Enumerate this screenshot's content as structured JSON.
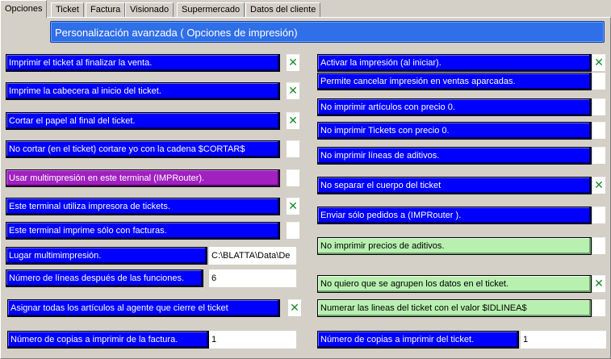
{
  "tabs": [
    {
      "label": "Opciones"
    },
    {
      "label": "Ticket"
    },
    {
      "label": "Factura"
    },
    {
      "label": "Visionado"
    },
    {
      "label": "Supermercado"
    },
    {
      "label": "Datos del cliente"
    }
  ],
  "header": {
    "title": "Personalización avanzada ( Opciones de impresión)"
  },
  "left": [
    {
      "label": "Imprimir el ticket al finalizar la venta.",
      "checked": true,
      "check_mark": "✕"
    },
    {
      "label": "Imprime la cabecera al inicio del ticket.",
      "checked": true,
      "check_mark": "✕"
    },
    {
      "label": "Cortar el papel al final del ticket.",
      "checked": true,
      "check_mark": "✕"
    },
    {
      "label": "No cortar (en el ticket) cortare yo con la cadena $CORTAR$",
      "checked": false,
      "check_mark": ""
    },
    {
      "label": "Usar multimpresión en este terminal (IMPRouter).",
      "checked": false,
      "check_mark": ""
    },
    {
      "label": "Este terminal  utiliza impresora de tickets.",
      "checked": true,
      "check_mark": "✕"
    },
    {
      "label": "Este terminal imprime sólo con facturas.",
      "checked": false,
      "check_mark": ""
    },
    {
      "label": "Lugar multimimpresión.",
      "value": "C:\\BLATTA\\Data\\De"
    },
    {
      "label": "Número de líneas después de las funciones.",
      "value": "6"
    },
    {
      "label": "Asignar todas los artículos al agente que cierre el ticket",
      "checked": true,
      "check_mark": "✕"
    },
    {
      "label": "Número de copias a imprimir de la factura.",
      "value": "1"
    }
  ],
  "right": [
    {
      "label": "Activar la impresión (al iniciar).",
      "checked": true,
      "check_mark": "✕"
    },
    {
      "label": "Permite cancelar impresión en ventas aparcadas.",
      "checked": false,
      "check_mark": ""
    },
    {
      "label": "No imprimir artículos con precio 0.",
      "checked": false,
      "check_mark": ""
    },
    {
      "label": "No imprimir Tickets con precio 0.",
      "checked": false,
      "check_mark": ""
    },
    {
      "label": "No imprimir líneas de aditivos.",
      "checked": false,
      "check_mark": ""
    },
    {
      "label": "No separar el cuerpo del ticket",
      "checked": true,
      "check_mark": "✕"
    },
    {
      "label": "Enviar sólo pedidos a (IMPRouter ).",
      "checked": false,
      "check_mark": ""
    },
    {
      "label": "No imprimir precios de aditivos.",
      "checked": false,
      "check_mark": ""
    },
    {
      "label": "No quiero que se agrupen los datos en el ticket.",
      "checked": true,
      "check_mark": "✕"
    },
    {
      "label": "Numerar las lineas del ticket con el valor $IDLINEA$",
      "checked": false,
      "check_mark": ""
    },
    {
      "label": "Número de copias a imprimir del ticket.",
      "value": "1"
    }
  ],
  "colors": {
    "accent_blue": "#0000ff",
    "purple": "#a020c0",
    "green": "#b8f0b0",
    "check": "#1a8a2a"
  }
}
